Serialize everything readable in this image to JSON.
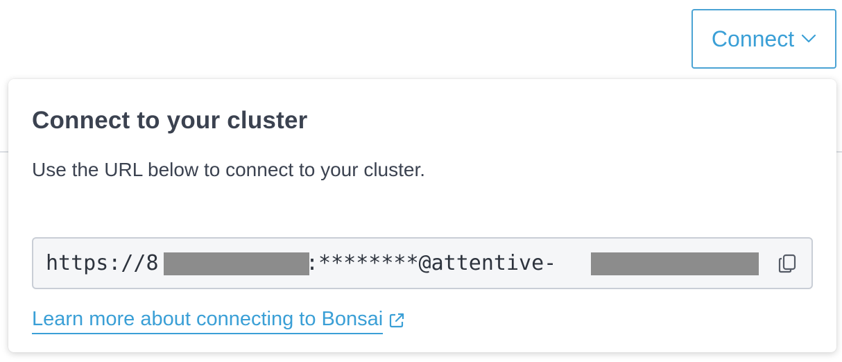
{
  "header": {
    "connect_button_label": "Connect",
    "connect_button_icon": "chevron-down-icon"
  },
  "popover": {
    "title": "Connect to your cluster",
    "description": "Use the URL below to connect to your cluster.",
    "url_field": {
      "value_prefix": "https://8",
      "value_middle": ":********@attentive-",
      "copy_icon": "copy-icon"
    },
    "learn_more_link": {
      "label": "Learn more about connecting to Bonsai",
      "icon": "external-link-icon"
    }
  },
  "colors": {
    "accent": "#3a9fd6",
    "title_text": "#3b4250",
    "field_bg": "#f5f6f8",
    "redaction": "#8c8c8c"
  }
}
